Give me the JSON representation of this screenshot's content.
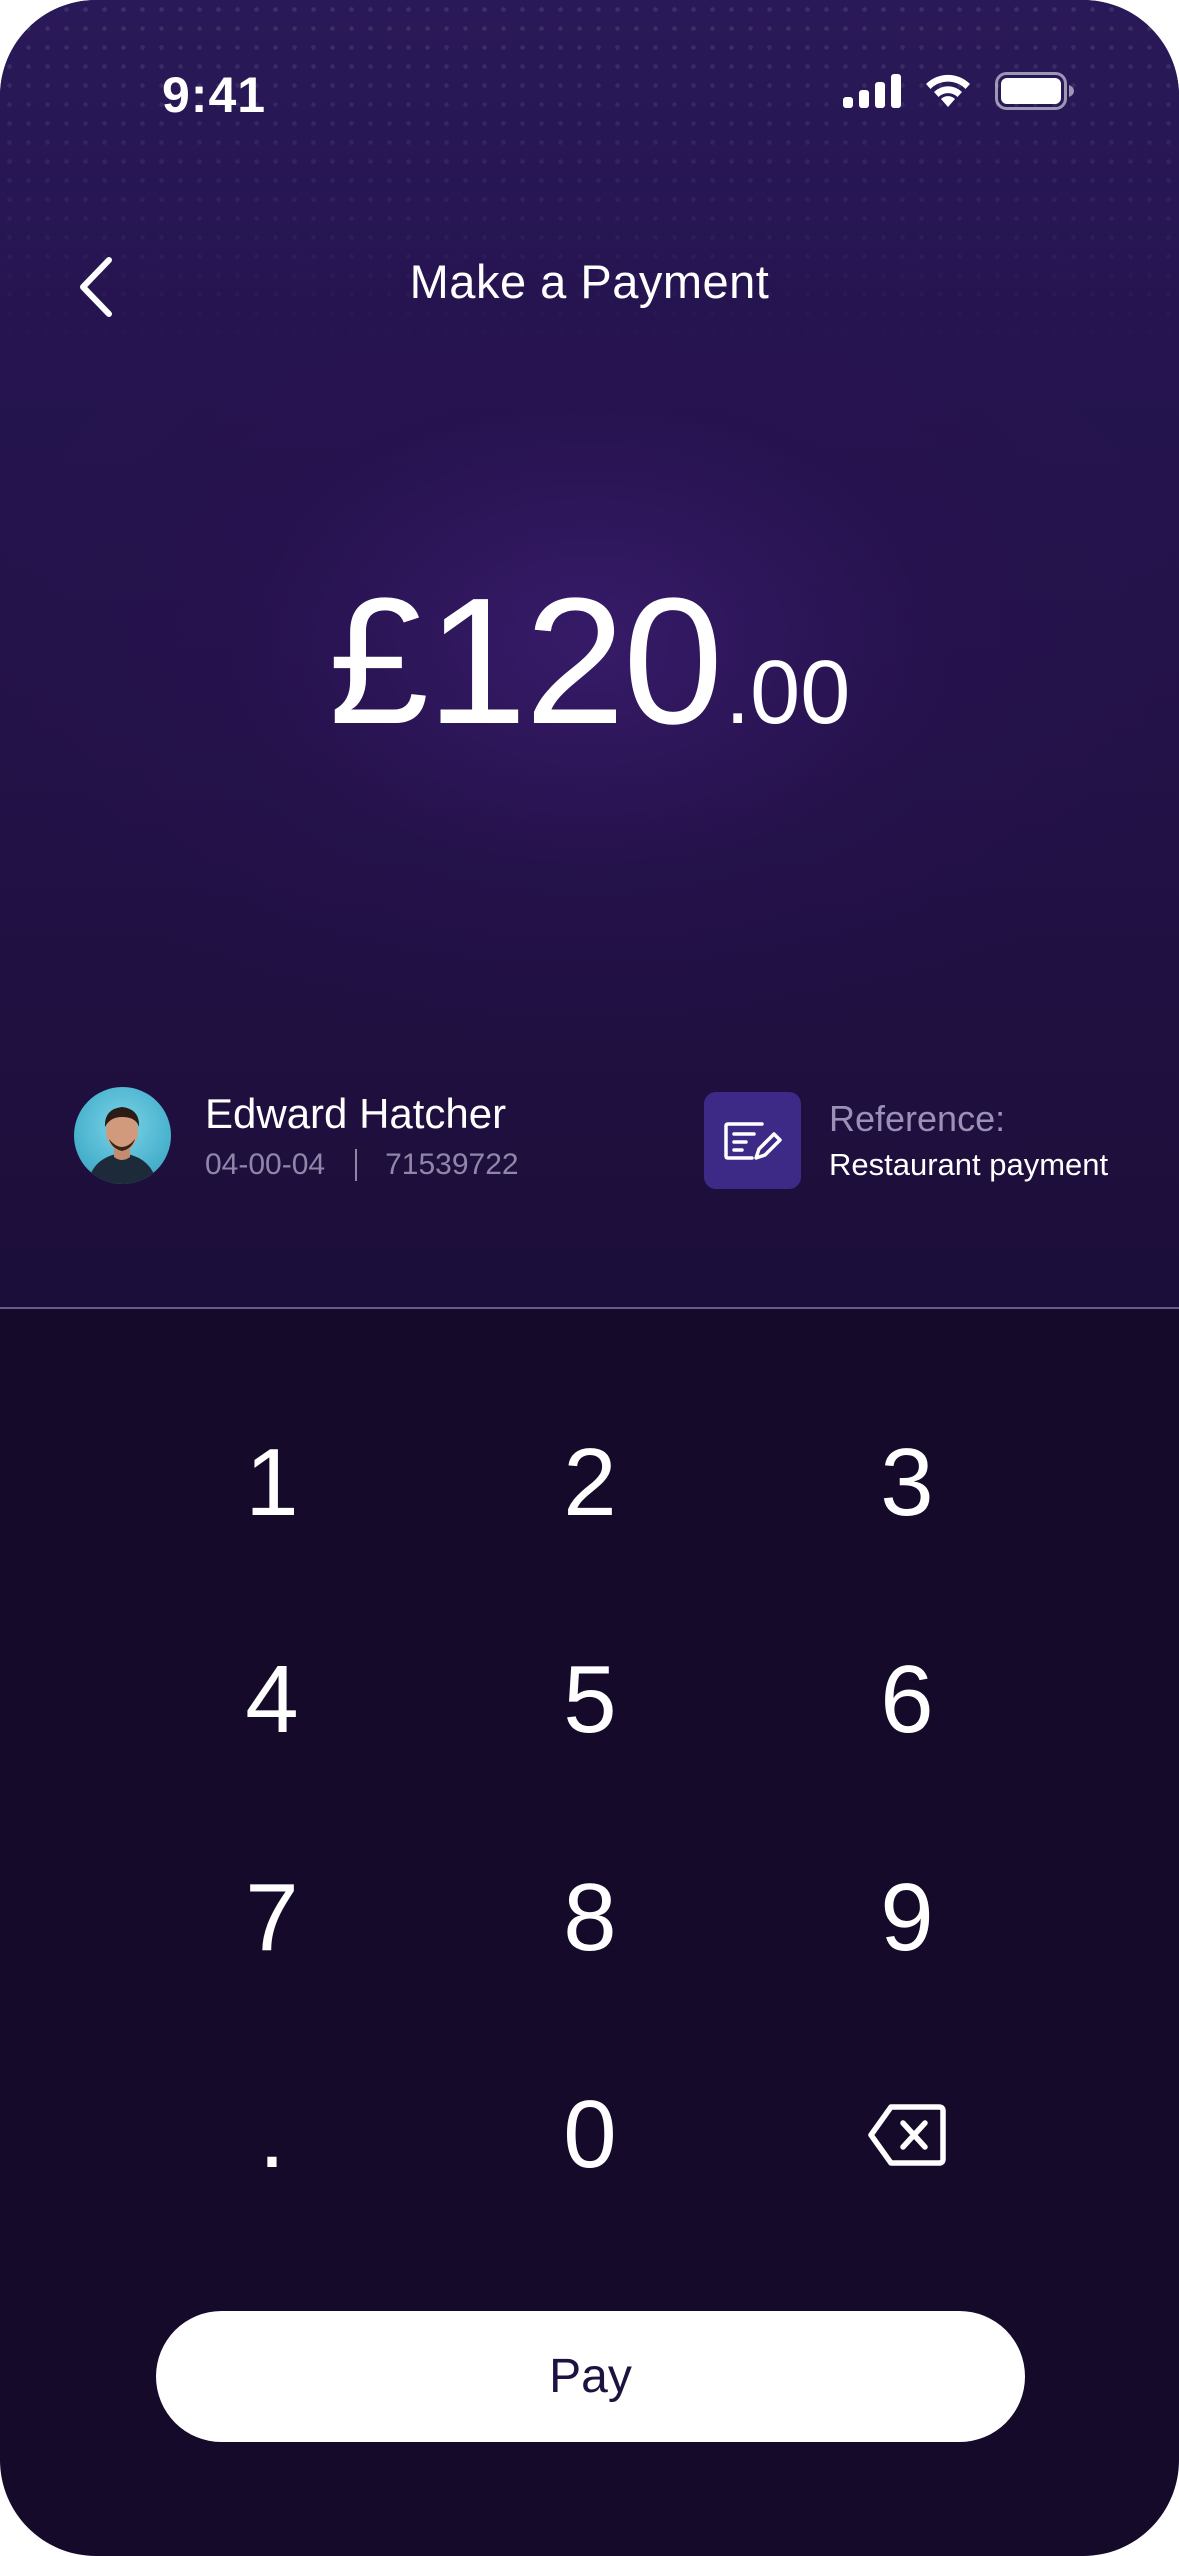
{
  "status_bar": {
    "time": "9:41",
    "signal_icon": "cellular-signal-icon",
    "wifi_icon": "wifi-icon",
    "battery_icon": "battery-icon"
  },
  "header": {
    "back_icon": "chevron-left-icon",
    "title": "Make a Payment"
  },
  "amount": {
    "whole": "£120",
    "decimal": ".00"
  },
  "recipient": {
    "avatar": "avatar",
    "name": "Edward Hatcher",
    "sort_code": "04-00-04",
    "account_number": "71539722"
  },
  "reference": {
    "icon": "note-edit-icon",
    "label": "Reference:",
    "value": "Restaurant payment"
  },
  "keypad": {
    "keys": [
      "1",
      "2",
      "3",
      "4",
      "5",
      "6",
      "7",
      "8",
      "9",
      ".",
      "0",
      ""
    ],
    "backspace_icon": "backspace-icon"
  },
  "pay_button": {
    "label": "Pay"
  },
  "colors": {
    "background_top": "#251450",
    "background_bottom": "#150a2a",
    "reference_icon_bg": "#3d2a86",
    "pay_button_bg": "#ffffff",
    "pay_button_text": "#1e1340"
  }
}
